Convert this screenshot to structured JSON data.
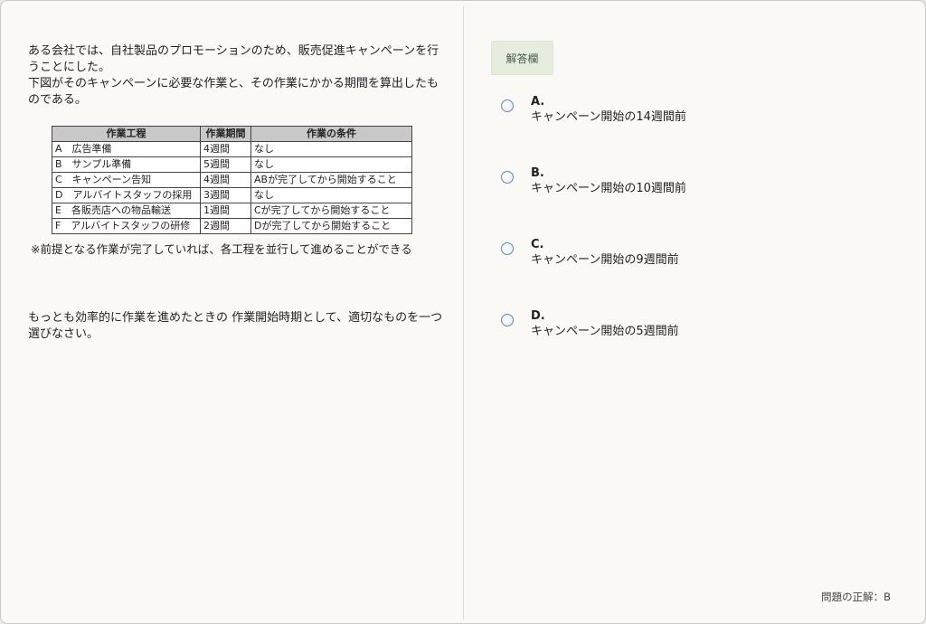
{
  "question": {
    "intro": "ある会社では、自社製品のプロモーションのため、販売促進キャンペーンを行うことにした。",
    "intro2": "下図がそのキャンペーンに必要な作業と、その作業にかかる期間を算出したものである。",
    "table": {
      "headers": [
        "作業工程",
        "作業期間",
        "作業の条件"
      ],
      "rows": [
        [
          "A　広告準備",
          "4週間",
          "なし"
        ],
        [
          "B　サンプル準備",
          "5週間",
          "なし"
        ],
        [
          "C　キャンペーン告知",
          "4週間",
          "ABが完了してから開始すること"
        ],
        [
          "D　アルバイトスタッフの採用",
          "3週間",
          "なし"
        ],
        [
          "E　各販売店への物品輸送",
          "1週間",
          "Cが完了してから開始すること"
        ],
        [
          "F　アルバイトスタッフの研修",
          "2週間",
          "Dが完了してから開始すること"
        ]
      ]
    },
    "note": "※前提となる作業が完了していれば、各工程を並行して進めることができる",
    "prompt": "もっとも効率的に作業を進めたときの 作業開始時期として、適切なものを一つ選びなさい。"
  },
  "answer": {
    "tab_label": "解答欄",
    "options": [
      {
        "letter": "A.",
        "text": "キャンペーン開始の14週間前"
      },
      {
        "letter": "B.",
        "text": "キャンペーン開始の10週間前"
      },
      {
        "letter": "C.",
        "text": "キャンペーン開始の9週間前"
      },
      {
        "letter": "D.",
        "text": "キャンペーン開始の5週間前"
      }
    ],
    "correct_label": "問題の正解：B"
  }
}
